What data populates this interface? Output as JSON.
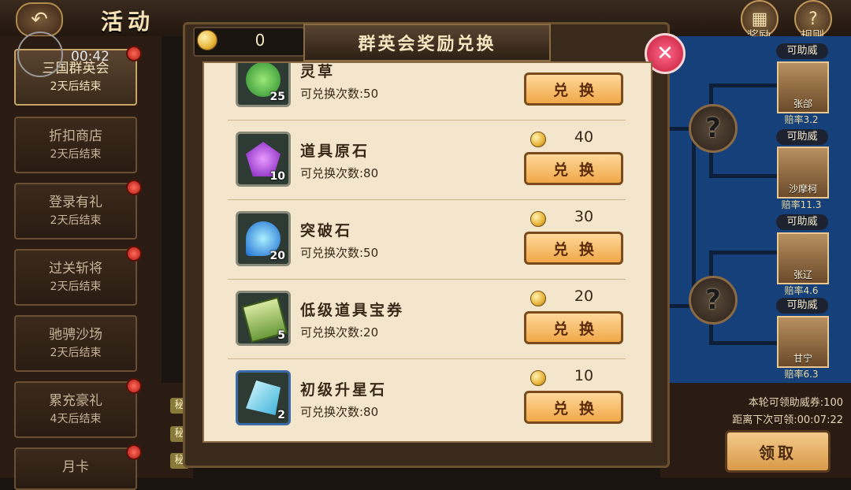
{
  "header": {
    "title": "活动",
    "reward_label": "奖励",
    "rules_label": "规则",
    "clock": "00:42"
  },
  "sidebar": {
    "items": [
      {
        "name": "三国群英会",
        "sub": "2天后结束",
        "active": true
      },
      {
        "name": "折扣商店",
        "sub": "2天后结束",
        "active": false
      },
      {
        "name": "登录有礼",
        "sub": "2天后结束",
        "active": false
      },
      {
        "name": "过关斩将",
        "sub": "2天后结束",
        "active": false
      },
      {
        "name": "驰骋沙场",
        "sub": "2天后结束",
        "active": false
      },
      {
        "name": "累充豪礼",
        "sub": "4天后结束",
        "active": false
      },
      {
        "name": "月卡",
        "sub": "",
        "active": false
      }
    ]
  },
  "modal": {
    "title": "群英会奖励兑换",
    "coin_balance": "0",
    "close_label": "✕",
    "items": [
      {
        "name": "灵草",
        "limit": "可兑换次数:50",
        "count": "25",
        "price": "",
        "button": "兑换",
        "gem_color": "#4aa83a"
      },
      {
        "name": "道具原石",
        "limit": "可兑换次数:80",
        "count": "10",
        "price": "40",
        "button": "兑换",
        "gem_color": "#9a3ad8"
      },
      {
        "name": "突破石",
        "limit": "可兑换次数:50",
        "count": "20",
        "price": "30",
        "button": "兑换",
        "gem_color": "#2a9ad8"
      },
      {
        "name": "低级道具宝券",
        "limit": "可兑换次数:20",
        "count": "5",
        "price": "20",
        "button": "兑换",
        "gem_color": "#6a9a3a"
      },
      {
        "name": "初级升星石",
        "limit": "可兑换次数:80",
        "count": "2",
        "price": "10",
        "button": "兑换",
        "gem_color": "#5ad0e8"
      }
    ]
  },
  "bracket": {
    "heroes": [
      {
        "tag": "可助威",
        "name": "张郃",
        "odds": "赔率3.2"
      },
      {
        "tag": "可助威",
        "name": "沙摩柯",
        "odds": "赔率11.3"
      },
      {
        "tag": "可助威",
        "name": "张辽",
        "odds": "赔率4.6"
      },
      {
        "tag": "可助威",
        "name": "甘宁",
        "odds": "赔率6.3"
      }
    ],
    "unknown_label": "?"
  },
  "footer": {
    "cheer_ticket": "本轮可领助威券:100",
    "next_claim": "距离下次可领:00:07:22",
    "claim_button": "领取",
    "secret_label": "秘"
  }
}
